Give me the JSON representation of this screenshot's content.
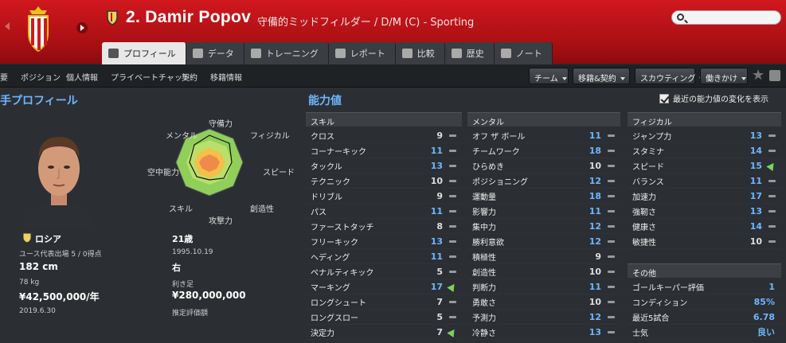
{
  "header": {
    "number_name": "2. Damir Popov",
    "subtitle": "守備的ミッドフィルダー / D/M (C) - Sporting",
    "search_placeholder": ""
  },
  "tabs": [
    {
      "label": "プロフィール",
      "active": true,
      "icon": "profile-icon"
    },
    {
      "label": "データ",
      "active": false,
      "icon": "stats-icon"
    },
    {
      "label": "トレーニング",
      "active": false,
      "icon": "training-icon"
    },
    {
      "label": "レポート",
      "active": false,
      "icon": "report-icon"
    },
    {
      "label": "比較",
      "active": false,
      "icon": "compare-icon"
    },
    {
      "label": "歴史",
      "active": false,
      "icon": "history-icon"
    },
    {
      "label": "ノート",
      "active": false,
      "icon": "note-icon"
    }
  ],
  "subnav": {
    "items": [
      "概要",
      "ポジション",
      "個人情報",
      "プライベートチャット",
      "契約",
      "移籍情報"
    ],
    "buttons": [
      "チーム",
      "移籍&契約",
      "スカウティング",
      "働きかけ"
    ]
  },
  "profile": {
    "heading": "選手プロフィール",
    "nationality": "ロシア",
    "youth_caps": "ユース代表出場 5 / 0得点",
    "height": "182 cm",
    "weight": "78 kg",
    "wage": "¥42,500,000/年",
    "contract_end": "2019.6.30",
    "age": "21歳",
    "dob": "1995.10.19",
    "foot": "右",
    "foot_label": "利き足",
    "value": "¥280,000,000",
    "value_label": "推定評価額"
  },
  "radar": {
    "labels": [
      "守備力",
      "フィジカル",
      "スピード",
      "創造性",
      "攻撃力",
      "スキル",
      "空中能力",
      "メンタル"
    ]
  },
  "attributes": {
    "heading": "能力値",
    "show_recent": "最近の能力値の変化を表示",
    "skill": {
      "title": "スキル",
      "rows": [
        {
          "name": "クロス",
          "value": "9",
          "trend": "flat"
        },
        {
          "name": "コーナーキック",
          "value": "11",
          "trend": "flat"
        },
        {
          "name": "タックル",
          "value": "13",
          "trend": "flat"
        },
        {
          "name": "テクニック",
          "value": "10",
          "trend": "flat"
        },
        {
          "name": "ドリブル",
          "value": "9",
          "trend": "flat"
        },
        {
          "name": "パス",
          "value": "11",
          "trend": "flat"
        },
        {
          "name": "ファーストタッチ",
          "value": "8",
          "trend": "flat"
        },
        {
          "name": "フリーキック",
          "value": "13",
          "trend": "flat"
        },
        {
          "name": "ヘディング",
          "value": "11",
          "trend": "flat"
        },
        {
          "name": "ペナルティキック",
          "value": "5",
          "trend": "flat"
        },
        {
          "name": "マーキング",
          "value": "17",
          "trend": "up"
        },
        {
          "name": "ロングシュート",
          "value": "7",
          "trend": "flat"
        },
        {
          "name": "ロングスロー",
          "value": "5",
          "trend": "flat"
        },
        {
          "name": "決定力",
          "value": "7",
          "trend": "up"
        }
      ]
    },
    "mental": {
      "title": "メンタル",
      "rows": [
        {
          "name": "オフ ザ ボール",
          "value": "11",
          "trend": "flat"
        },
        {
          "name": "チームワーク",
          "value": "18",
          "trend": "flat"
        },
        {
          "name": "ひらめき",
          "value": "10",
          "trend": "flat"
        },
        {
          "name": "ポジショニング",
          "value": "12",
          "trend": "flat"
        },
        {
          "name": "運動量",
          "value": "18",
          "trend": "flat"
        },
        {
          "name": "影響力",
          "value": "11",
          "trend": "flat"
        },
        {
          "name": "集中力",
          "value": "12",
          "trend": "flat"
        },
        {
          "name": "勝利意欲",
          "value": "12",
          "trend": "flat"
        },
        {
          "name": "積極性",
          "value": "9",
          "trend": "flat"
        },
        {
          "name": "創造性",
          "value": "10",
          "trend": "flat"
        },
        {
          "name": "判断力",
          "value": "11",
          "trend": "flat"
        },
        {
          "name": "勇敢さ",
          "value": "10",
          "trend": "flat"
        },
        {
          "name": "予測力",
          "value": "12",
          "trend": "flat"
        },
        {
          "name": "冷静さ",
          "value": "13",
          "trend": "flat"
        }
      ]
    },
    "physical": {
      "title": "フィジカル",
      "rows": [
        {
          "name": "ジャンプ力",
          "value": "13",
          "trend": "flat"
        },
        {
          "name": "スタミナ",
          "value": "14",
          "trend": "flat"
        },
        {
          "name": "スピード",
          "value": "15",
          "trend": "up"
        },
        {
          "name": "バランス",
          "value": "11",
          "trend": "flat"
        },
        {
          "name": "加速力",
          "value": "17",
          "trend": "flat"
        },
        {
          "name": "強靭さ",
          "value": "13",
          "trend": "flat"
        },
        {
          "name": "健康さ",
          "value": "14",
          "trend": "flat"
        },
        {
          "name": "敏捷性",
          "value": "10",
          "trend": "flat"
        }
      ]
    },
    "other": {
      "title": "その他",
      "rows": [
        {
          "name": "ゴールキーパー評価",
          "value": "1"
        },
        {
          "name": "コンディション",
          "value": "85%"
        },
        {
          "name": "最近5試合",
          "value": "6.78"
        },
        {
          "name": "士気",
          "value": "良い"
        }
      ]
    }
  },
  "colors": {
    "header_red": "#c4141a",
    "accent_blue": "#6fb6ff",
    "trend_up": "#7ad35a"
  }
}
